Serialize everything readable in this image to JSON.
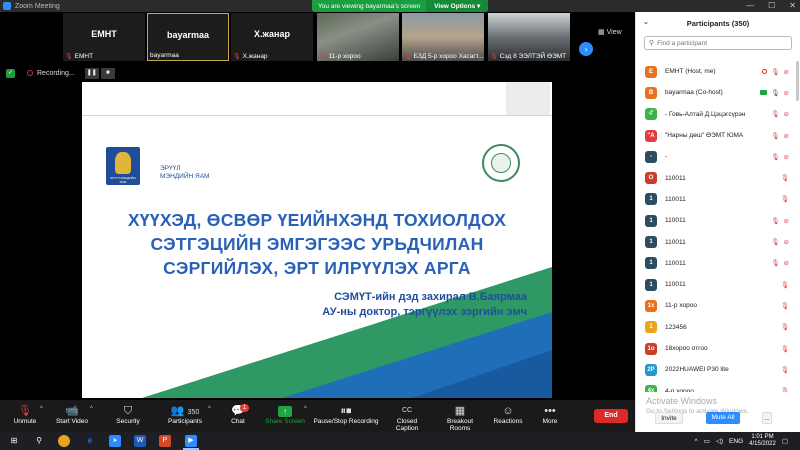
{
  "window": {
    "title": "Zoom Meeting",
    "controls": [
      "—",
      "☐",
      "✕"
    ]
  },
  "banner": {
    "text": "You are viewing bayarmaa's screen",
    "options_label": "View Options ▾"
  },
  "thumbnails": [
    {
      "name": "ЕМНТ",
      "label": "ЕМНТ"
    },
    {
      "name": "bayarmaa",
      "label": "bayarmaa"
    },
    {
      "name": "Х.жанар",
      "label": "Х.жанар"
    },
    {
      "name": "",
      "label": "11-р хороо"
    },
    {
      "name": "",
      "label": "БЗД 5-р хороо Хасагт..."
    },
    {
      "name": "",
      "label": "Сэд 8 ЭЭЛТЭЙ ӨЭМТ"
    }
  ],
  "view_label": "View",
  "recording": {
    "text": "Recording..."
  },
  "slide": {
    "logo_left_text": "ЭРҮҮЛ\nМЭНДИЙН ЯАМ",
    "logo_left_small": "ЭРҮҮЛ МЭНДИЙН ЯАМ",
    "title_lines": [
      "ХҮҮХЭД, ӨСВӨР ҮЕИЙНХЭНД ТОХИОЛДОХ",
      "СЭТГЭЦИЙН ЭМГЭГЭЭС УРЬДЧИЛАН",
      "СЭРГИЙЛЭХ, ЭРТ ИЛРҮҮЛЭХ АРГА"
    ],
    "author_lines": [
      "СЭМҮТ-ийн дэд захирал В.Баярмаа",
      "АУ-ны доктор, тэргүүлэх зэргийн эмч"
    ]
  },
  "toolbar": {
    "unmute": "Unmute",
    "start_video": "Start Video",
    "security": "Security",
    "participants": "Participants",
    "participants_count": "350",
    "chat": "Chat",
    "chat_badge": "1",
    "share_screen": "Share Screen",
    "pause_recording": "Pause/Stop Recording",
    "closed_caption": "Closed Caption",
    "breakout_rooms": "Breakout Rooms",
    "reactions": "Reactions",
    "more": "More",
    "end": "End"
  },
  "panel": {
    "title": "Participants (350)",
    "search_placeholder": "Find a participant",
    "participants": [
      {
        "initial": "E",
        "color": "#e8711f",
        "name": "ЕМНТ (Host, me)",
        "icons": "rec-mic-cam"
      },
      {
        "initial": "B",
        "color": "#e8711f",
        "name": "bayarmaa (Co-host)",
        "icons": "recg-micok-cam"
      },
      {
        "initial": "-Г",
        "color": "#3bb34a",
        "name": "- Говь-Алтай Д.Цэцэгсүрэн",
        "icons": "mic-cam"
      },
      {
        "initial": "\"А",
        "color": "#e23b3b",
        "name": "\"Нарны дөш\" ӨЭМТ ЮМА",
        "icons": "mic-cam"
      },
      {
        "initial": "-",
        "color": "#2b4c63",
        "name": "-",
        "icons": "mic-cam"
      },
      {
        "initial": "O",
        "color": "#c8402c",
        "name": "110011",
        "icons": "mic"
      },
      {
        "initial": "1",
        "color": "#2b4c63",
        "name": "110011",
        "icons": "mic"
      },
      {
        "initial": "1",
        "color": "#2b4c63",
        "name": "110011",
        "icons": "mic-cam"
      },
      {
        "initial": "1",
        "color": "#2b4c63",
        "name": "110011",
        "icons": "mic-cam"
      },
      {
        "initial": "1",
        "color": "#2b4c63",
        "name": "110011",
        "icons": "mic-cam"
      },
      {
        "initial": "1",
        "color": "#2b4c63",
        "name": "110011",
        "icons": "mic"
      },
      {
        "initial": "1x",
        "color": "#e8711f",
        "name": "11-р хороо",
        "icons": "mic"
      },
      {
        "initial": "1",
        "color": "#e8a41f",
        "name": "123456",
        "icons": "mic"
      },
      {
        "initial": "1o",
        "color": "#c8402c",
        "name": "18хороо отгоо",
        "icons": "mic"
      },
      {
        "initial": "2P",
        "color": "#1f9ac8",
        "name": "2022HUAWEI P30 lite",
        "icons": "mic"
      },
      {
        "initial": "4x",
        "color": "#3bb34a",
        "name": "4-р хороо",
        "icons": "mic"
      }
    ],
    "watermark_title": "Activate Windows",
    "watermark_sub": "Go to Settings to activate Windows.",
    "invite": "Invite",
    "mute_all": "Mute All",
    "more": "..."
  },
  "taskbar": {
    "language": "ENG",
    "time": "1:01 PM",
    "date": "4/15/2022"
  }
}
